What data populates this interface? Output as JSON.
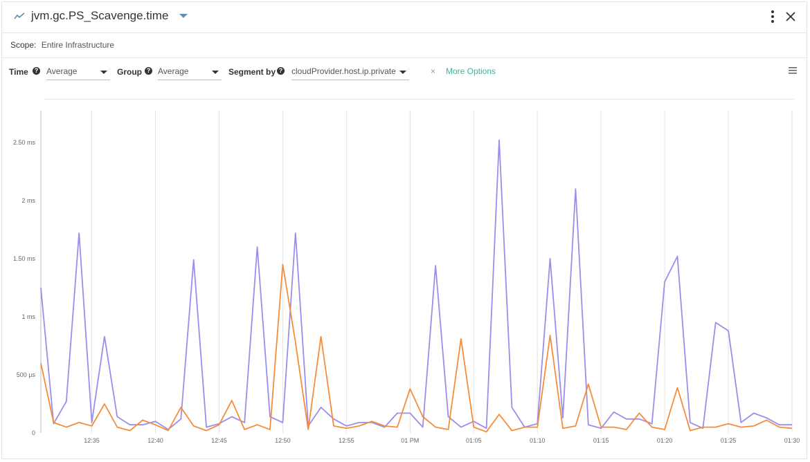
{
  "header": {
    "title": "jvm.gc.PS_Scavenge.time",
    "icons": [
      "metric-line-icon",
      "dropdown-caret-icon",
      "more-vertical-icon",
      "close-icon"
    ]
  },
  "scope": {
    "label": "Scope:",
    "value": "Entire Infrastructure"
  },
  "controls": {
    "time_label": "Time",
    "time_value": "Average",
    "group_label": "Group",
    "group_value": "Average",
    "segment_label": "Segment by",
    "segment_value": "cloudProvider.host.ip.private",
    "clear_label": "×",
    "more_options_label": "More Options",
    "help_glyph": "?"
  },
  "colors": {
    "accent": "#3cb39b",
    "series_purple": "#9c8cec",
    "series_orange": "#f68c3a"
  },
  "chart_data": {
    "type": "line",
    "x": [
      "12:31",
      "12:32",
      "12:33",
      "12:34",
      "12:35",
      "12:36",
      "12:37",
      "12:38",
      "12:39",
      "12:40",
      "12:41",
      "12:42",
      "12:43",
      "12:44",
      "12:45",
      "12:46",
      "12:47",
      "12:48",
      "12:49",
      "12:50",
      "12:51",
      "12:52",
      "12:53",
      "12:54",
      "12:55",
      "12:56",
      "12:57",
      "12:58",
      "12:59",
      "01 PM",
      "01:01",
      "01:02",
      "01:03",
      "01:04",
      "01:05",
      "01:06",
      "01:07",
      "01:08",
      "01:09",
      "01:10",
      "01:11",
      "01:12",
      "01:13",
      "01:14",
      "01:15",
      "01:16",
      "01:17",
      "01:18",
      "01:19",
      "01:20",
      "01:21",
      "01:22",
      "01:23",
      "01:24",
      "01:25",
      "01:26",
      "01:27",
      "01:28",
      "01:29",
      "01:30"
    ],
    "x_tick_labels": [
      "12:35",
      "12:40",
      "12:45",
      "12:50",
      "12:55",
      "01 PM",
      "01:05",
      "01:10",
      "01:15",
      "01:20",
      "01:25",
      "01:30"
    ],
    "y_tick_labels": [
      "0",
      "500 µs",
      "1 ms",
      "1.50 ms",
      "2 ms",
      "2.50 ms"
    ],
    "ylim": [
      0,
      2.8
    ],
    "yunit": "ms",
    "grid": "vertical",
    "series": [
      {
        "color": "#9c8cec",
        "values": [
          1.25,
          0.08,
          0.27,
          1.72,
          0.09,
          0.83,
          0.14,
          0.07,
          0.07,
          0.1,
          0.03,
          0.12,
          1.49,
          0.05,
          0.08,
          0.14,
          0.09,
          1.6,
          0.14,
          0.09,
          1.72,
          0.06,
          0.22,
          0.12,
          0.06,
          0.09,
          0.09,
          0.05,
          0.17,
          0.17,
          0.05,
          1.44,
          0.14,
          0.05,
          0.1,
          0.04,
          2.52,
          0.22,
          0.05,
          0.08,
          1.5,
          0.13,
          2.1,
          0.07,
          0.04,
          0.18,
          0.12,
          0.12,
          0.08,
          1.3,
          1.52,
          0.09,
          0.04,
          0.95,
          0.88,
          0.09,
          0.17,
          0.13,
          0.07,
          0.07
        ]
      },
      {
        "color": "#f68c3a",
        "values": [
          0.6,
          0.09,
          0.05,
          0.09,
          0.06,
          0.25,
          0.05,
          0.02,
          0.11,
          0.07,
          0.02,
          0.22,
          0.06,
          0.02,
          0.07,
          0.28,
          0.03,
          0.07,
          0.03,
          1.45,
          0.78,
          0.03,
          0.83,
          0.06,
          0.04,
          0.06,
          0.1,
          0.06,
          0.05,
          0.38,
          0.14,
          0.05,
          0.03,
          0.81,
          0.05,
          0.01,
          0.16,
          0.02,
          0.05,
          0.05,
          0.84,
          0.04,
          0.06,
          0.42,
          0.05,
          0.05,
          0.03,
          0.17,
          0.05,
          0.03,
          0.39,
          0.02,
          0.05,
          0.05,
          0.08,
          0.05,
          0.06,
          0.11,
          0.05,
          0.04
        ]
      }
    ]
  }
}
